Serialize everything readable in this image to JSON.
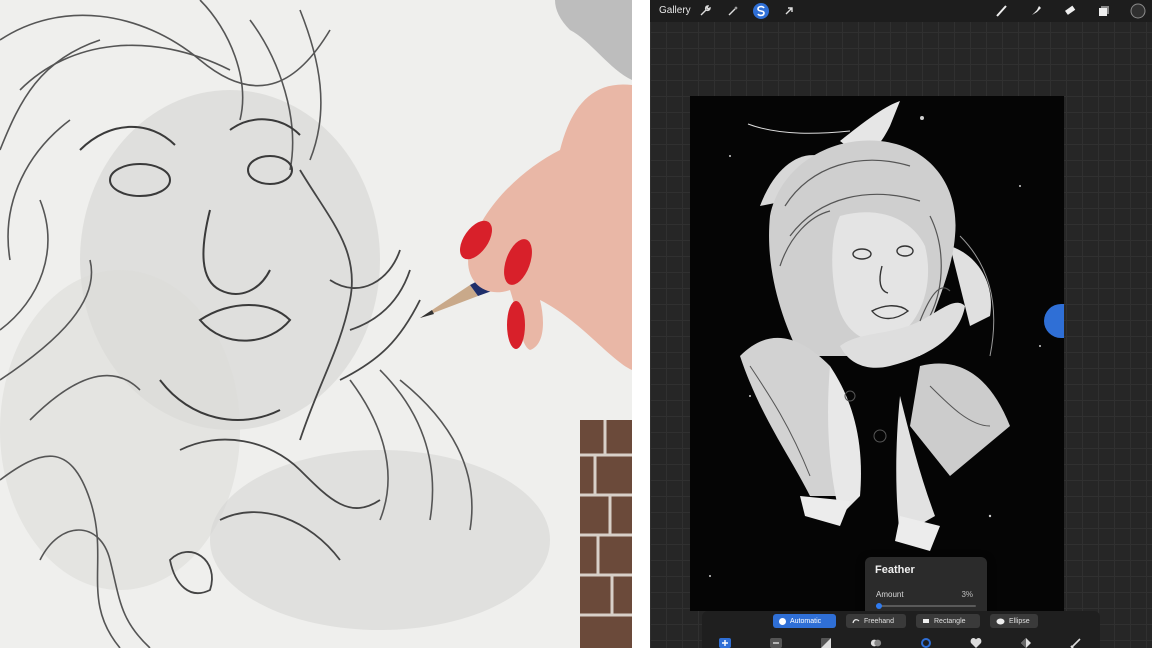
{
  "topbar": {
    "gallery_label": "Gallery",
    "left_tools": [
      "wrench-icon",
      "magic-wand-icon",
      "selection-icon",
      "transform-arrow-icon"
    ],
    "right_tools": [
      "brush-icon",
      "smudge-icon",
      "eraser-icon",
      "layers-icon",
      "color-swatch-icon"
    ],
    "active_color": "#303030"
  },
  "feather_popup": {
    "title": "Feather",
    "amount_label": "Amount",
    "amount_value": "3%",
    "amount_fraction": 0.03
  },
  "selection_modes": [
    {
      "label": "Automatic",
      "active": true
    },
    {
      "label": "Freehand",
      "active": false
    },
    {
      "label": "Rectangle",
      "active": false
    },
    {
      "label": "Ellipse",
      "active": false
    }
  ],
  "bottom_tools": [
    "add-icon",
    "subtract-icon",
    "invert-icon",
    "copy-paste-icon",
    "feather-icon",
    "save-load-icon",
    "color-fill-icon",
    "clear-icon"
  ],
  "colors": {
    "accent": "#2f6fd6",
    "panel": "#1f1f1f",
    "canvas_bg": "#050505"
  }
}
